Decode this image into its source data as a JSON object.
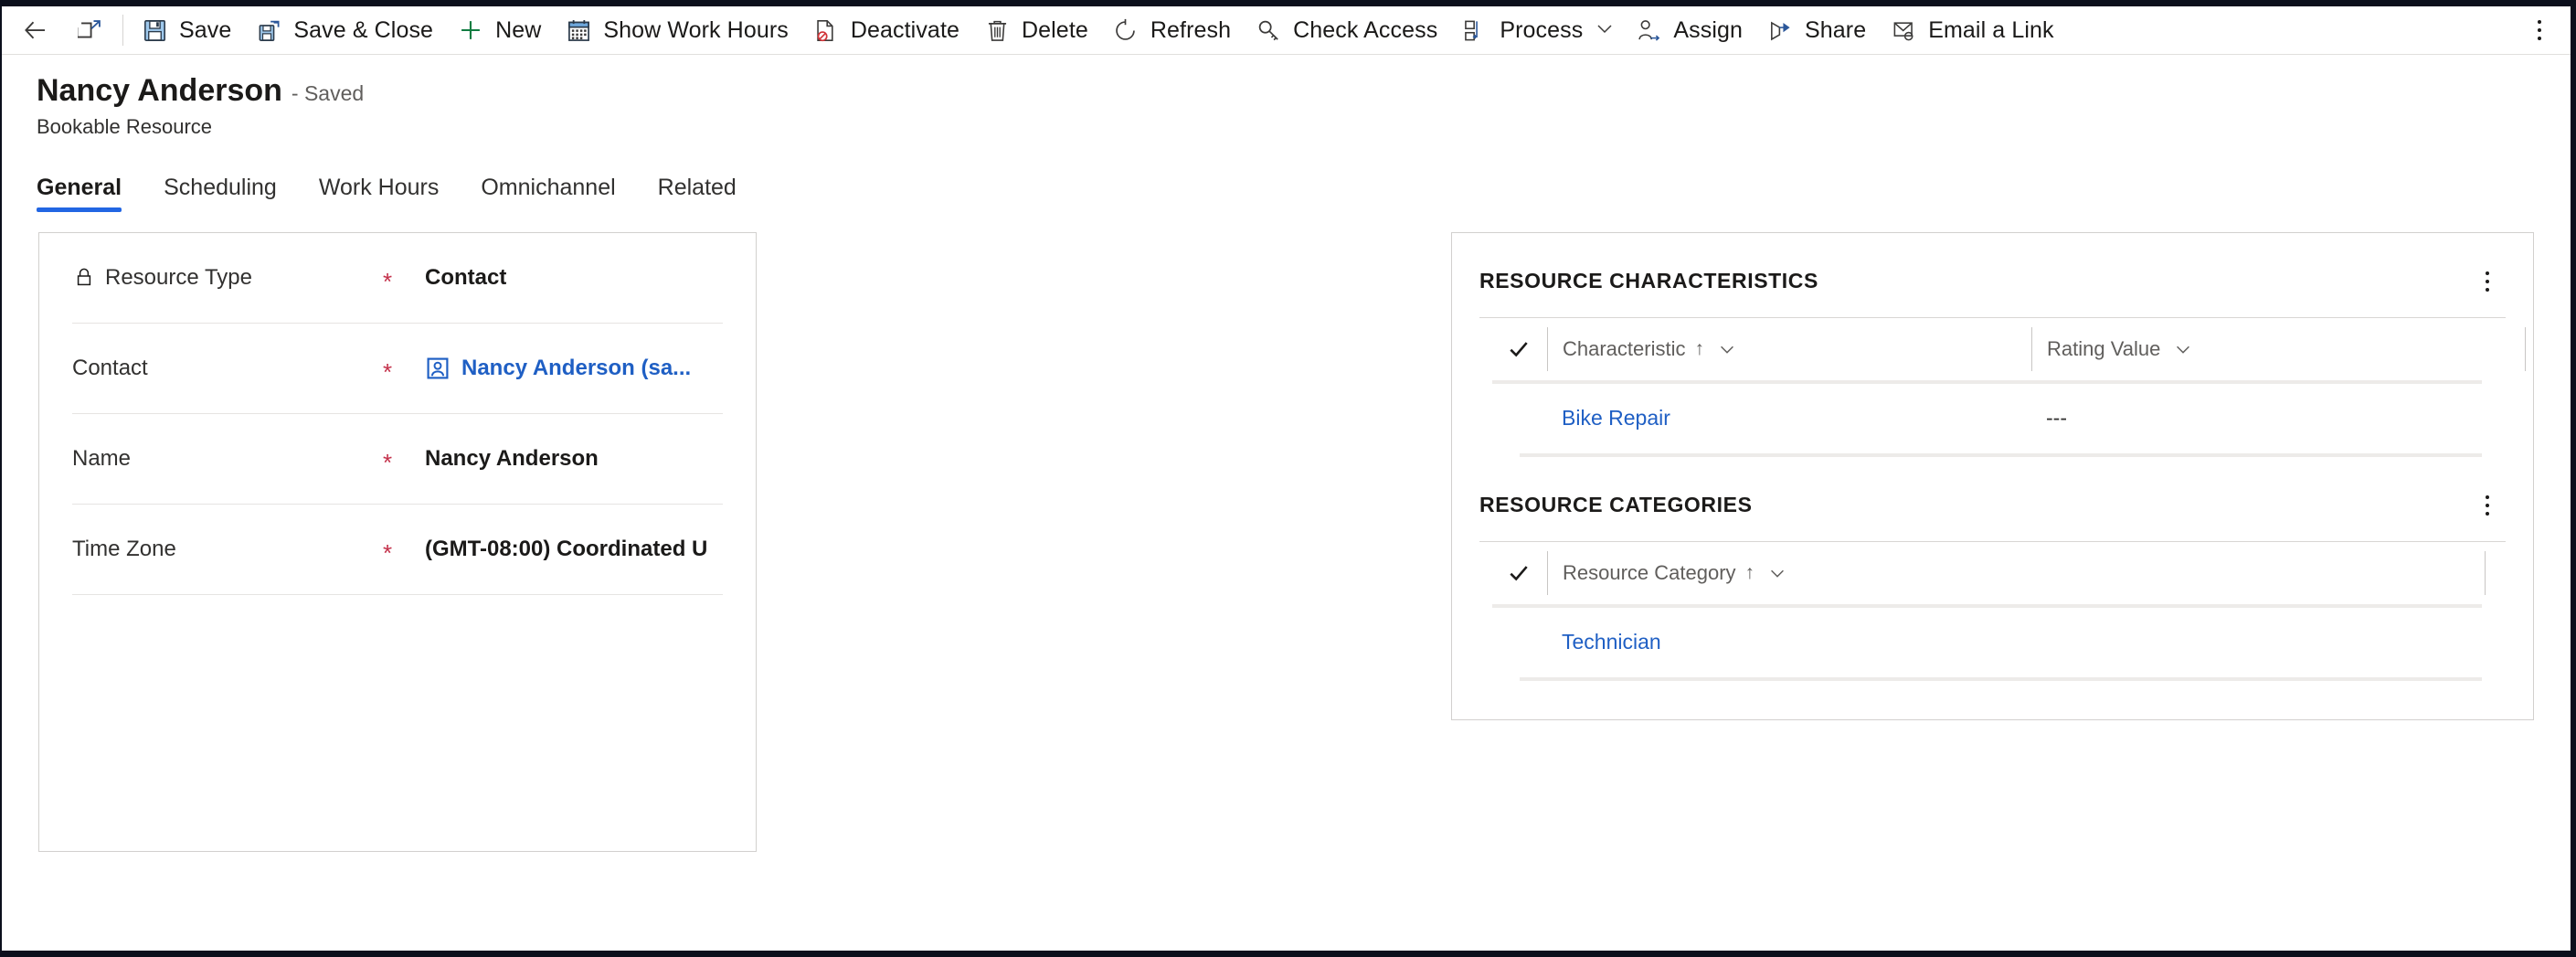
{
  "commandbar": {
    "back_label": "Back",
    "popout_label": "Open in new window",
    "buttons": [
      {
        "id": "save",
        "icon": "save-icon",
        "label": "Save"
      },
      {
        "id": "save-close",
        "icon": "save-and-close-icon",
        "label": "Save & Close"
      },
      {
        "id": "new",
        "icon": "plus-icon",
        "label": "New"
      },
      {
        "id": "show-work-hours",
        "icon": "calendar-icon",
        "label": "Show Work Hours"
      },
      {
        "id": "deactivate",
        "icon": "deactivate-icon",
        "label": "Deactivate"
      },
      {
        "id": "delete",
        "icon": "trash-icon",
        "label": "Delete"
      },
      {
        "id": "refresh",
        "icon": "refresh-icon",
        "label": "Refresh"
      },
      {
        "id": "check-access",
        "icon": "key-icon",
        "label": "Check Access"
      },
      {
        "id": "process",
        "icon": "process-icon",
        "label": "Process"
      },
      {
        "id": "assign",
        "icon": "assign-person-icon",
        "label": "Assign"
      },
      {
        "id": "share",
        "icon": "share-icon",
        "label": "Share"
      },
      {
        "id": "email-a-link",
        "icon": "email-link-icon",
        "label": "Email a Link"
      }
    ],
    "overflow_label": "More commands"
  },
  "header": {
    "title": "Nancy Anderson",
    "status": "- Saved",
    "subtitle": "Bookable Resource"
  },
  "tabs": [
    {
      "label": "General",
      "active": true
    },
    {
      "label": "Scheduling",
      "active": false
    },
    {
      "label": "Work Hours",
      "active": false
    },
    {
      "label": "Omnichannel",
      "active": false
    },
    {
      "label": "Related",
      "active": false
    }
  ],
  "form": {
    "fields": [
      {
        "label": "Resource Type",
        "required": "*",
        "value": "Contact",
        "locked": true,
        "link": false,
        "bold": true
      },
      {
        "label": "Contact",
        "required": "*",
        "value": "Nancy Anderson (sa...",
        "locked": false,
        "link": true,
        "bold": true
      },
      {
        "label": "Name",
        "required": "*",
        "value": "Nancy Anderson",
        "locked": false,
        "link": false,
        "bold": true
      },
      {
        "label": "Time Zone",
        "required": "*",
        "value": "(GMT-08:00) Coordinated U",
        "locked": false,
        "link": false,
        "bold": true
      }
    ]
  },
  "subgrids": [
    {
      "title": "RESOURCE CHARACTERISTICS",
      "more_label": "More commands",
      "columns": [
        {
          "label": "Characteristic",
          "sorted": "↑"
        },
        {
          "label": "Rating Value",
          "sorted": ""
        }
      ],
      "rows": [
        {
          "c1": "Bike Repair",
          "c2": "---"
        }
      ]
    },
    {
      "title": "RESOURCE CATEGORIES",
      "more_label": "More commands",
      "columns": [
        {
          "label": "Resource Category",
          "sorted": "↑"
        }
      ],
      "rows": [
        {
          "c1": "Technician",
          "c2": ""
        }
      ]
    }
  ],
  "colors": {
    "accent": "#2266e3",
    "link": "#1f5fc4",
    "required": "#c4314b",
    "icon_blue": "#6ea8dd",
    "panel_border": "#d2d0ce"
  }
}
